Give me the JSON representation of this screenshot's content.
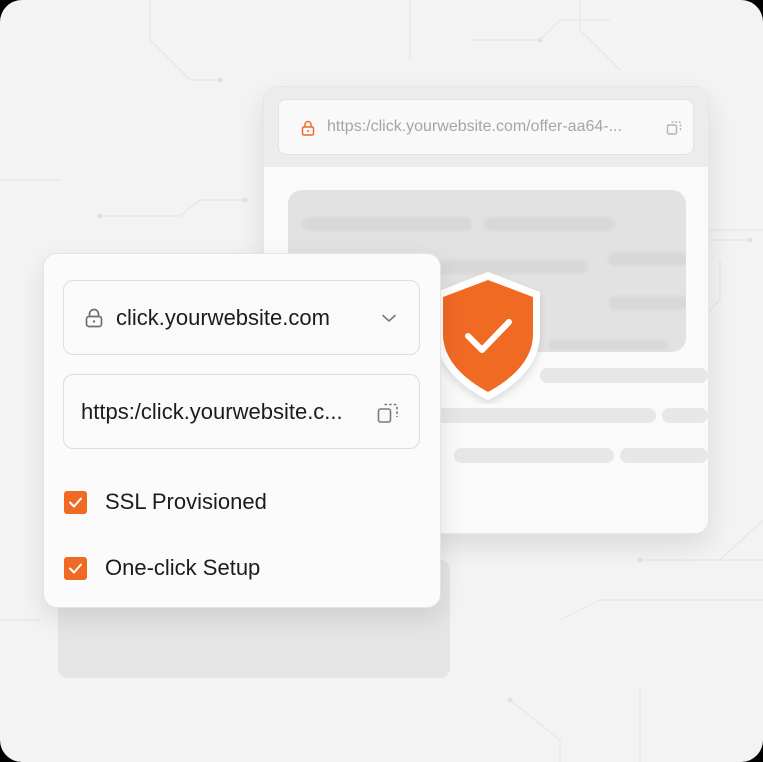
{
  "browser": {
    "address_url": "https:/click.yourwebsite.com/offer-aa64-..."
  },
  "panel": {
    "domain_select_value": "click.yourwebsite.com",
    "url_field_value": "https:/click.yourwebsite.c...",
    "checks": [
      {
        "label": "SSL Provisioned",
        "checked": true
      },
      {
        "label": "One-click Setup",
        "checked": true
      }
    ]
  },
  "icons": {
    "address_lock": "lock-icon",
    "address_copy": "copy-icon",
    "domain_lock": "lock-icon",
    "domain_chevron": "chevron-down-icon",
    "url_copy": "copy-icon",
    "shield": "shield-check-icon"
  },
  "colors": {
    "accent": "#f06a24",
    "background": "#f3f3f3"
  }
}
